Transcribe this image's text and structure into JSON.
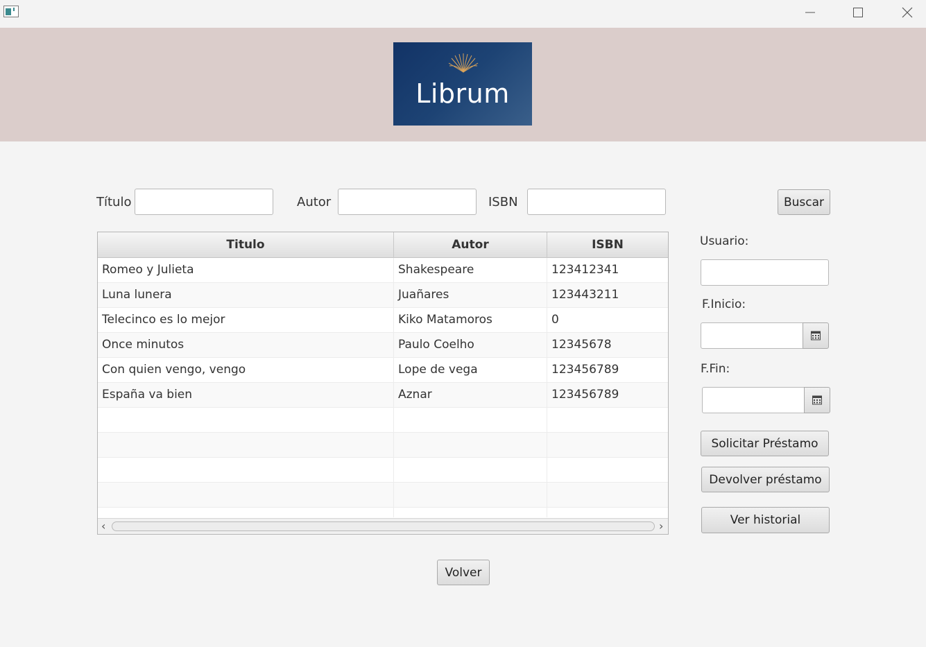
{
  "window": {
    "icons": {
      "app": "java-app-icon",
      "minimize": "minimize-icon",
      "maximize": "maximize-icon",
      "close": "close-icon"
    }
  },
  "header": {
    "logo_text": "Librum",
    "logo_icon": "open-book-rays-icon",
    "bg_color": "#dbcdcb"
  },
  "search": {
    "titulo_label": "Título",
    "titulo_value": "",
    "autor_label": "Autor",
    "autor_value": "",
    "isbn_label": "ISBN",
    "isbn_value": "",
    "buscar_label": "Buscar"
  },
  "table": {
    "columns": [
      "Titulo",
      "Autor",
      "ISBN"
    ],
    "rows": [
      [
        "Romeo y Julieta",
        "Shakespeare",
        "123412341"
      ],
      [
        "Luna lunera",
        "Juañares",
        "123443211"
      ],
      [
        "Telecinco es lo mejor",
        "Kiko Matamoros",
        "0"
      ],
      [
        "Once minutos",
        "Paulo Coelho",
        "12345678"
      ],
      [
        "Con quien vengo, vengo",
        "Lope de vega",
        "123456789"
      ],
      [
        "España va bien",
        "Aznar",
        "123456789"
      ]
    ]
  },
  "loan": {
    "usuario_label": "Usuario:",
    "usuario_value": "",
    "inicio_label": "F.Inicio:",
    "inicio_value": "",
    "fin_label": "F.Fin:",
    "fin_value": "",
    "calendar_icon": "calendar-icon",
    "solicitar_label": "Solicitar Préstamo",
    "devolver_label": "Devolver préstamo",
    "historial_label": "Ver historial"
  },
  "footer": {
    "volver_label": "Volver"
  }
}
